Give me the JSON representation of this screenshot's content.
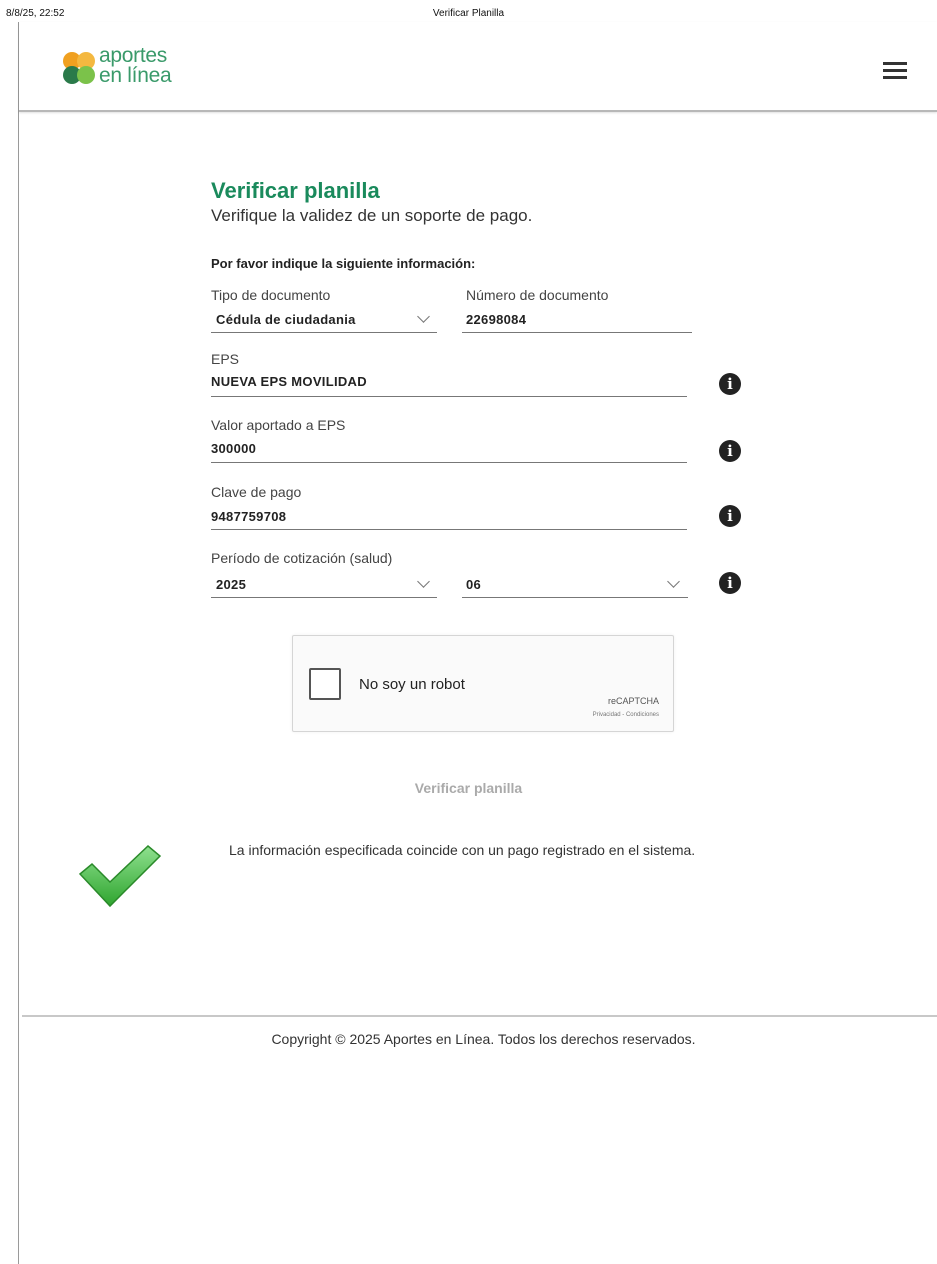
{
  "print": {
    "datetime": "8/8/25, 22:52",
    "title": "Verificar Planilla"
  },
  "header": {
    "logo_line1": "aportes",
    "logo_line2": "en línea",
    "menu_icon": "hamburger-menu-icon"
  },
  "page": {
    "title": "Verificar planilla",
    "subtitle": "Verifique la validez de un soporte de pago.",
    "instructions": "Por favor indique la siguiente información:"
  },
  "form": {
    "doc_type": {
      "label": "Tipo de documento",
      "value": "Cédula de ciudadania"
    },
    "doc_number": {
      "label": "Número de documento",
      "value": "22698084"
    },
    "eps": {
      "label": "EPS",
      "value": "NUEVA EPS MOVILIDAD"
    },
    "eps_value": {
      "label": "Valor aportado a EPS",
      "value": "300000"
    },
    "payment_key": {
      "label": "Clave de pago",
      "value": "9487759708"
    },
    "period": {
      "label": "Período de cotización (salud)",
      "year": "2025",
      "month": "06"
    }
  },
  "captcha": {
    "label": "No soy un robot",
    "brand": "reCAPTCHA",
    "links": "Privacidad - Condiciones"
  },
  "verify_button": "Verificar planilla",
  "result_message": "La información especificada coincide con un pago registrado en el sistema.",
  "footer": {
    "copyright": "Copyright © 2025 Aportes en Línea. Todos los derechos reservados."
  },
  "colors": {
    "accent": "#1a8a5c",
    "logo_orange": "#f0a020",
    "logo_green": "#5cb85c",
    "logo_dark": "#2a7a4a",
    "check_green": "#4cc24c"
  }
}
